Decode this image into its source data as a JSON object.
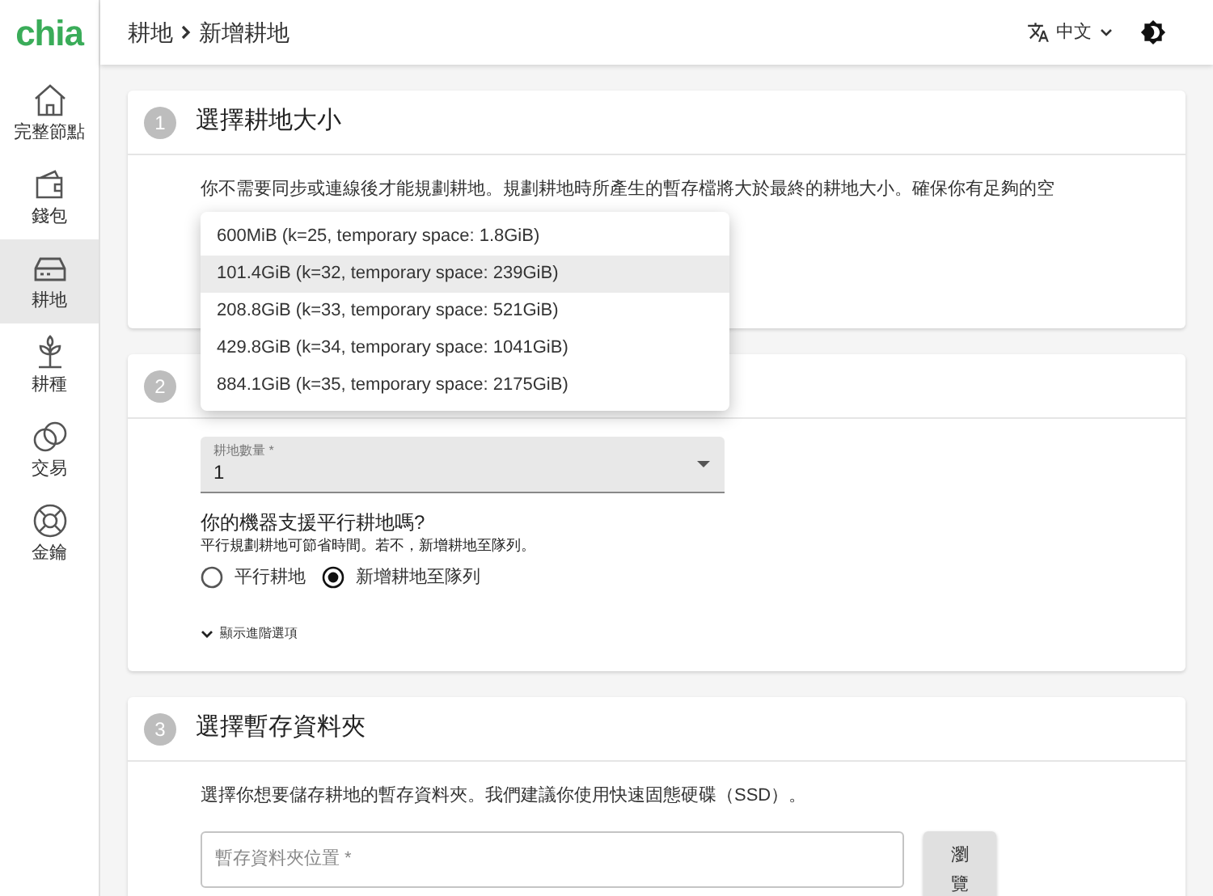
{
  "logo": "chia",
  "sidebar": {
    "items": [
      {
        "label": "完整節點",
        "kind": "home",
        "selected": false
      },
      {
        "label": "錢包",
        "kind": "wallet",
        "selected": false
      },
      {
        "label": "耕地",
        "kind": "drive",
        "selected": true
      },
      {
        "label": "耕種",
        "kind": "sprout",
        "selected": false
      },
      {
        "label": "交易",
        "kind": "rings",
        "selected": false
      },
      {
        "label": "金鑰",
        "kind": "buoy",
        "selected": false
      }
    ]
  },
  "breadcrumb": [
    "耕地",
    "新增耕地"
  ],
  "header": {
    "language": "中文"
  },
  "steps": [
    {
      "number": "1",
      "title": "選擇耕地大小",
      "description": "你不需要同步或連線後才能規劃耕地。規劃耕地時所產生的暫存檔將大於最終的耕地大小。確保你有足夠的空"
    },
    {
      "number": "2",
      "count_field": {
        "label": "耕地數量 *",
        "value": "1"
      },
      "question": "你的機器支援平行耕地嗎?",
      "hint": "平行規劃耕地可節省時間。若不，新增耕地至隊列。",
      "options": [
        {
          "label": "平行耕地",
          "selected": false
        },
        {
          "label": "新增耕地至隊列",
          "selected": true
        }
      ],
      "advanced": "顯示進階選項"
    },
    {
      "number": "3",
      "title": "選擇暫存資料夾",
      "description": "選擇你想要儲存耕地的暫存資料夾。我們建議你使用快速固態硬碟（SSD）。",
      "folder_field": {
        "placeholder": "暫存資料夾位置 *"
      },
      "browse_button": "瀏覽"
    }
  ],
  "size_menu": [
    {
      "label": "600MiB (k=25, temporary space: 1.8GiB)",
      "selected": false
    },
    {
      "label": "101.4GiB (k=32, temporary space: 239GiB)",
      "selected": true
    },
    {
      "label": "208.8GiB (k=33, temporary space: 521GiB)",
      "selected": false
    },
    {
      "label": "429.8GiB (k=34, temporary space: 1041GiB)",
      "selected": false
    },
    {
      "label": "884.1GiB (k=35, temporary space: 2175GiB)",
      "selected": false
    }
  ]
}
